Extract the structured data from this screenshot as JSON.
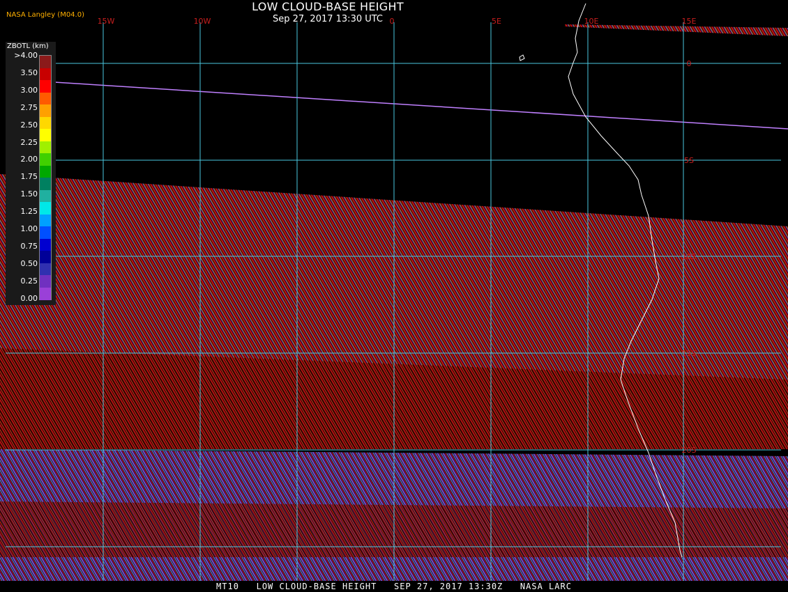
{
  "title": "LOW CLOUD-BASE HEIGHT",
  "subtitle": "Sep 27, 2017 13:30 UTC",
  "provider": "NASA Langley (M04.0)",
  "legend": {
    "title": "ZBOTL (km)",
    "labels": [
      ">4.00",
      "3.50",
      "3.00",
      "2.75",
      "2.50",
      "2.25",
      "2.00",
      "1.75",
      "1.50",
      "1.25",
      "1.00",
      "0.75",
      "0.50",
      "0.25",
      "0.00"
    ],
    "colors": [
      "#8b1a1a",
      "#c80000",
      "#ff0000",
      "#ff5a00",
      "#ffa000",
      "#ffd800",
      "#ffff00",
      "#a0f000",
      "#40d000",
      "#00a800",
      "#008060",
      "#20b0a0",
      "#00e8e8",
      "#00a0ff",
      "#0050ff",
      "#0000d0",
      "#000098",
      "#3030b0",
      "#7030c0",
      "#9a40d8"
    ]
  },
  "grid": {
    "longitude_labels": [
      "15W",
      "10W",
      "0",
      "5E",
      "10E",
      "15E"
    ],
    "latitude_labels": [
      "0",
      "5S",
      "10S",
      "15S",
      "20S"
    ],
    "line_color": "#4ac8e0",
    "label_color": "#c81e1e"
  },
  "footer": "MT10   LOW CLOUD-BASE HEIGHT   SEP 27, 2017 13:30Z   NASA LARC",
  "colors": {
    "background": "#000000",
    "coastline": "#ffffff",
    "cloud_dominant": "#a01010"
  }
}
